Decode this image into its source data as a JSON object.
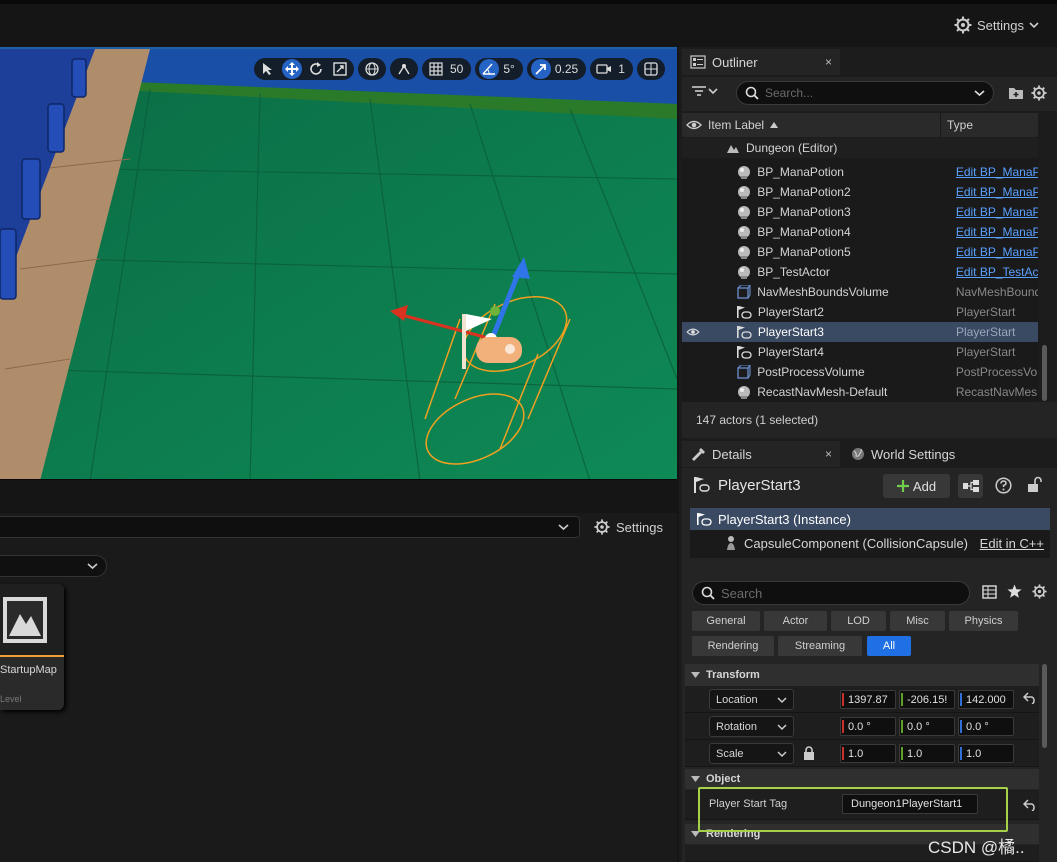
{
  "topbar": {
    "settings_label": "Settings"
  },
  "viewport": {
    "grid_snap": "50",
    "rotation_snap": "5°",
    "scale_snap": "0.25",
    "camera_speed": "1"
  },
  "content_browser": {
    "settings_label": "Settings",
    "asset_name": "StartupMap",
    "asset_type": "Level"
  },
  "outliner": {
    "tab_label": "Outliner",
    "close_glyph": "×",
    "search_placeholder": "Search...",
    "col_label": "Item Label",
    "col_type": "Type",
    "world": "Dungeon (Editor)",
    "rows": [
      {
        "label": "BP_ManaPotion",
        "type": "Edit BP_ManaP",
        "icon": "sphere-icon",
        "link": true
      },
      {
        "label": "BP_ManaPotion2",
        "type": "Edit BP_ManaP",
        "icon": "sphere-icon",
        "link": true
      },
      {
        "label": "BP_ManaPotion3",
        "type": "Edit BP_ManaP",
        "icon": "sphere-icon",
        "link": true
      },
      {
        "label": "BP_ManaPotion4",
        "type": "Edit BP_ManaP",
        "icon": "sphere-icon",
        "link": true
      },
      {
        "label": "BP_ManaPotion5",
        "type": "Edit BP_ManaP",
        "icon": "sphere-icon",
        "link": true
      },
      {
        "label": "BP_TestActor",
        "type": "Edit BP_TestAc",
        "icon": "sphere-icon",
        "link": true
      },
      {
        "label": "NavMeshBoundsVolume",
        "type": "NavMeshBound",
        "icon": "volume-icon",
        "link": false
      },
      {
        "label": "PlayerStart2",
        "type": "PlayerStart",
        "icon": "player-start-icon",
        "link": false
      },
      {
        "label": "PlayerStart3",
        "type": "PlayerStart",
        "icon": "player-start-icon",
        "link": false,
        "selected": true
      },
      {
        "label": "PlayerStart4",
        "type": "PlayerStart",
        "icon": "player-start-icon",
        "link": false
      },
      {
        "label": "PostProcessVolume",
        "type": "PostProcessVo",
        "icon": "volume-icon",
        "link": false
      },
      {
        "label": "RecastNavMesh-Default",
        "type": "RecastNavMes",
        "icon": "sphere-icon",
        "link": false
      }
    ],
    "status": "147 actors (1 selected)"
  },
  "details": {
    "tab_label": "Details",
    "close_glyph": "×",
    "world_settings_label": "World Settings",
    "actor_name": "PlayerStart3",
    "add_label": "Add",
    "instance_label": "PlayerStart3 (Instance)",
    "component_label": "CapsuleComponent (CollisionCapsule)",
    "edit_cpp_label": "Edit in C++",
    "search_placeholder": "Search",
    "categories": [
      "General",
      "Actor",
      "LOD",
      "Misc",
      "Physics",
      "Rendering",
      "Streaming",
      "All"
    ],
    "transform": {
      "section": "Transform",
      "location_label": "Location",
      "rotation_label": "Rotation",
      "scale_label": "Scale",
      "location": [
        "1397.87",
        "-206.15!",
        "142.000"
      ],
      "rotation": [
        "0.0 °",
        "0.0 °",
        "0.0 °"
      ],
      "scale": [
        "1.0",
        "1.0",
        "1.0"
      ]
    },
    "object": {
      "section": "Object",
      "player_start_tag_label": "Player Start Tag",
      "player_start_tag_value": "Dungeon1PlayerStart1"
    },
    "rendering_section": "Rendering",
    "axis_colors": {
      "x": "#c8322d",
      "y": "#5fa12a",
      "z": "#2f6fd6"
    },
    "highlight_color": "#a6d24a"
  },
  "watermark": "CSDN @橘.."
}
